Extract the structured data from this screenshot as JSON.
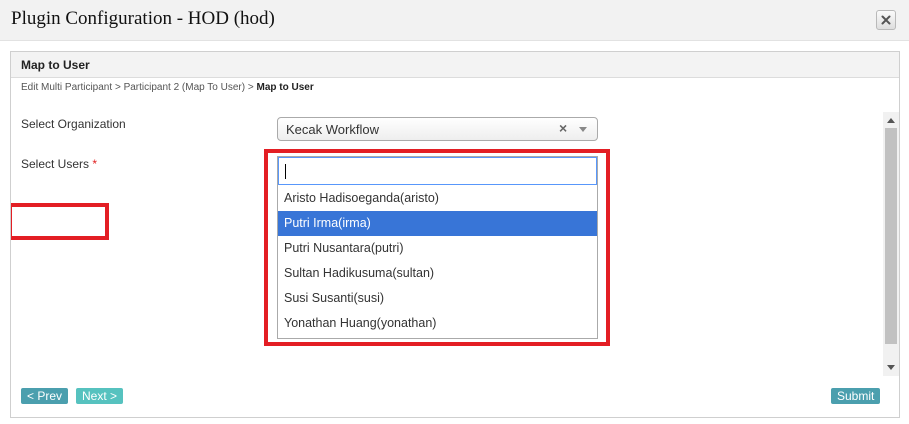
{
  "window": {
    "title": "Plugin Configuration - HOD (hod)"
  },
  "panel": {
    "title": "Map to User",
    "breadcrumb": {
      "items": [
        "Edit Multi Participant",
        "Participant 2 (Map To User)"
      ],
      "separator": ">",
      "current": "Map to User"
    }
  },
  "form": {
    "organization": {
      "label": "Select Organization",
      "value": "Kecak Workflow"
    },
    "users": {
      "label": "Select Users",
      "required_mark": "*",
      "search_value": "",
      "options": [
        "Aristo Hadisoeganda(aristo)",
        "Putri Irma(irma)",
        "Putri Nusantara(putri)",
        "Sultan Hadikusuma(sultan)",
        "Susi Susanti(susi)",
        "Yonathan Huang(yonathan)"
      ],
      "highlighted_option": "Putri Irma(irma)"
    }
  },
  "buttons": {
    "prev": "< Prev",
    "next": "Next >",
    "submit": "Submit"
  },
  "colors": {
    "highlight_border": "#e31e24",
    "selected_option_bg": "#3875d7",
    "button_bg": "#4b9fae",
    "next_button_bg": "#56c2bf"
  },
  "icons": {
    "close": "close-icon",
    "clear": "clear-icon",
    "dropdown_arrow": "chevron-down-icon"
  }
}
